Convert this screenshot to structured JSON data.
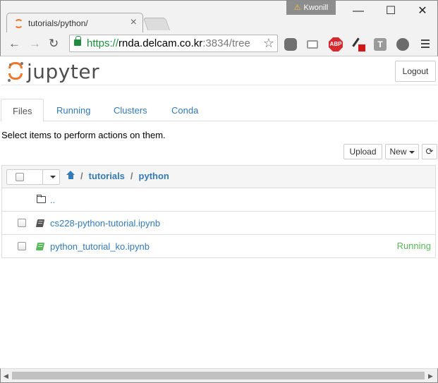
{
  "browser": {
    "tab_title": "tutorials/python/",
    "tab_close": "×",
    "profile_name": "Kwonill",
    "profile_warning": "⚠",
    "window_controls": {
      "minimize": "—",
      "maximize": "☐",
      "close": "✕"
    },
    "nav": {
      "back": "←",
      "forward": "→",
      "reload": "↻"
    },
    "address": {
      "scheme": "https://",
      "host": "rnda.delcam.co.kr",
      "rest": ":3834/tree",
      "star": "☆"
    },
    "extensions": {
      "abp_label": "ABP",
      "t_label": "T"
    },
    "accent": "#1e8e3e"
  },
  "jupyter": {
    "logo_text": "jupyter",
    "logout_label": "Logout",
    "tabs": [
      {
        "label": "Files",
        "active": true
      },
      {
        "label": "Running",
        "active": false
      },
      {
        "label": "Clusters",
        "active": false
      },
      {
        "label": "Conda",
        "active": false
      }
    ],
    "hint": "Select items to perform actions on them.",
    "upload_label": "Upload",
    "new_label": "New",
    "refresh_icon": "⟳",
    "breadcrumb": [
      "tutorials",
      "python"
    ],
    "breadcrumb_separator": "/",
    "items": [
      {
        "name": "..",
        "type": "folder",
        "status": ""
      },
      {
        "name": "cs228-python-tutorial.ipynb",
        "type": "notebook",
        "status": ""
      },
      {
        "name": "python_tutorial_ko.ipynb",
        "type": "notebook-running",
        "status": "Running"
      }
    ],
    "colors": {
      "link": "#337ab7",
      "running": "#5cb85c",
      "logo_orange": "#f37726"
    }
  },
  "scrollbar": {
    "left_arrow": "◀",
    "right_arrow": "▶"
  }
}
